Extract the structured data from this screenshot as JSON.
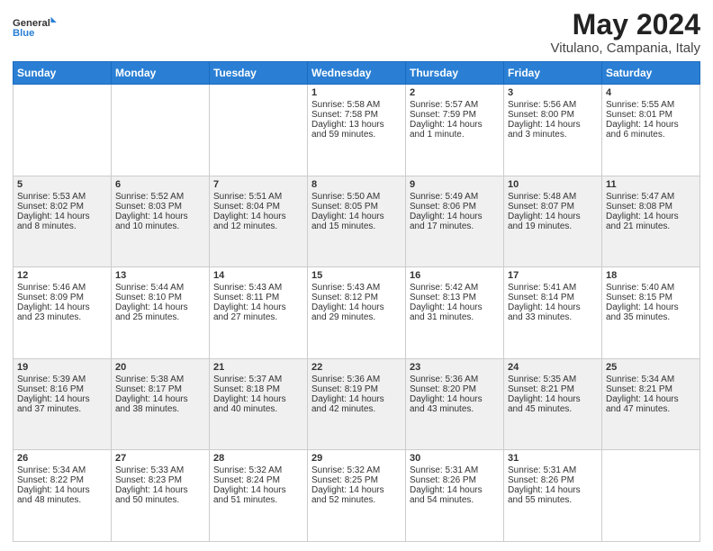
{
  "logo": {
    "line1": "General",
    "line2": "Blue"
  },
  "title": "May 2024",
  "subtitle": "Vitulano, Campania, Italy",
  "days_of_week": [
    "Sunday",
    "Monday",
    "Tuesday",
    "Wednesday",
    "Thursday",
    "Friday",
    "Saturday"
  ],
  "weeks": [
    [
      {
        "day": "",
        "content": ""
      },
      {
        "day": "",
        "content": ""
      },
      {
        "day": "",
        "content": ""
      },
      {
        "day": "1",
        "content": "Sunrise: 5:58 AM\nSunset: 7:58 PM\nDaylight: 13 hours and 59 minutes."
      },
      {
        "day": "2",
        "content": "Sunrise: 5:57 AM\nSunset: 7:59 PM\nDaylight: 14 hours and 1 minute."
      },
      {
        "day": "3",
        "content": "Sunrise: 5:56 AM\nSunset: 8:00 PM\nDaylight: 14 hours and 3 minutes."
      },
      {
        "day": "4",
        "content": "Sunrise: 5:55 AM\nSunset: 8:01 PM\nDaylight: 14 hours and 6 minutes."
      }
    ],
    [
      {
        "day": "5",
        "content": "Sunrise: 5:53 AM\nSunset: 8:02 PM\nDaylight: 14 hours and 8 minutes."
      },
      {
        "day": "6",
        "content": "Sunrise: 5:52 AM\nSunset: 8:03 PM\nDaylight: 14 hours and 10 minutes."
      },
      {
        "day": "7",
        "content": "Sunrise: 5:51 AM\nSunset: 8:04 PM\nDaylight: 14 hours and 12 minutes."
      },
      {
        "day": "8",
        "content": "Sunrise: 5:50 AM\nSunset: 8:05 PM\nDaylight: 14 hours and 15 minutes."
      },
      {
        "day": "9",
        "content": "Sunrise: 5:49 AM\nSunset: 8:06 PM\nDaylight: 14 hours and 17 minutes."
      },
      {
        "day": "10",
        "content": "Sunrise: 5:48 AM\nSunset: 8:07 PM\nDaylight: 14 hours and 19 minutes."
      },
      {
        "day": "11",
        "content": "Sunrise: 5:47 AM\nSunset: 8:08 PM\nDaylight: 14 hours and 21 minutes."
      }
    ],
    [
      {
        "day": "12",
        "content": "Sunrise: 5:46 AM\nSunset: 8:09 PM\nDaylight: 14 hours and 23 minutes."
      },
      {
        "day": "13",
        "content": "Sunrise: 5:44 AM\nSunset: 8:10 PM\nDaylight: 14 hours and 25 minutes."
      },
      {
        "day": "14",
        "content": "Sunrise: 5:43 AM\nSunset: 8:11 PM\nDaylight: 14 hours and 27 minutes."
      },
      {
        "day": "15",
        "content": "Sunrise: 5:43 AM\nSunset: 8:12 PM\nDaylight: 14 hours and 29 minutes."
      },
      {
        "day": "16",
        "content": "Sunrise: 5:42 AM\nSunset: 8:13 PM\nDaylight: 14 hours and 31 minutes."
      },
      {
        "day": "17",
        "content": "Sunrise: 5:41 AM\nSunset: 8:14 PM\nDaylight: 14 hours and 33 minutes."
      },
      {
        "day": "18",
        "content": "Sunrise: 5:40 AM\nSunset: 8:15 PM\nDaylight: 14 hours and 35 minutes."
      }
    ],
    [
      {
        "day": "19",
        "content": "Sunrise: 5:39 AM\nSunset: 8:16 PM\nDaylight: 14 hours and 37 minutes."
      },
      {
        "day": "20",
        "content": "Sunrise: 5:38 AM\nSunset: 8:17 PM\nDaylight: 14 hours and 38 minutes."
      },
      {
        "day": "21",
        "content": "Sunrise: 5:37 AM\nSunset: 8:18 PM\nDaylight: 14 hours and 40 minutes."
      },
      {
        "day": "22",
        "content": "Sunrise: 5:36 AM\nSunset: 8:19 PM\nDaylight: 14 hours and 42 minutes."
      },
      {
        "day": "23",
        "content": "Sunrise: 5:36 AM\nSunset: 8:20 PM\nDaylight: 14 hours and 43 minutes."
      },
      {
        "day": "24",
        "content": "Sunrise: 5:35 AM\nSunset: 8:21 PM\nDaylight: 14 hours and 45 minutes."
      },
      {
        "day": "25",
        "content": "Sunrise: 5:34 AM\nSunset: 8:21 PM\nDaylight: 14 hours and 47 minutes."
      }
    ],
    [
      {
        "day": "26",
        "content": "Sunrise: 5:34 AM\nSunset: 8:22 PM\nDaylight: 14 hours and 48 minutes."
      },
      {
        "day": "27",
        "content": "Sunrise: 5:33 AM\nSunset: 8:23 PM\nDaylight: 14 hours and 50 minutes."
      },
      {
        "day": "28",
        "content": "Sunrise: 5:32 AM\nSunset: 8:24 PM\nDaylight: 14 hours and 51 minutes."
      },
      {
        "day": "29",
        "content": "Sunrise: 5:32 AM\nSunset: 8:25 PM\nDaylight: 14 hours and 52 minutes."
      },
      {
        "day": "30",
        "content": "Sunrise: 5:31 AM\nSunset: 8:26 PM\nDaylight: 14 hours and 54 minutes."
      },
      {
        "day": "31",
        "content": "Sunrise: 5:31 AM\nSunset: 8:26 PM\nDaylight: 14 hours and 55 minutes."
      },
      {
        "day": "",
        "content": ""
      }
    ]
  ]
}
